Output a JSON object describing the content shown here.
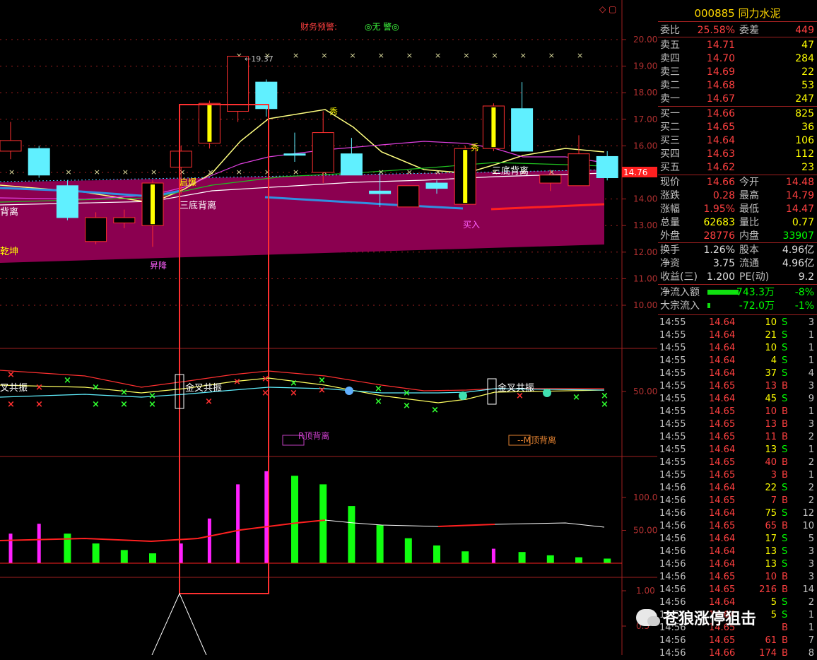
{
  "top_bar": {
    "warn_label": "财务预警:",
    "warn_value": "◎无 警◎"
  },
  "top_icons": "◇ ▢",
  "price_axis": [
    "20.00",
    "19.00",
    "18.00",
    "17.00",
    "16.00",
    "15.00",
    "14.00",
    "13.00",
    "12.00",
    "11.00",
    "10.00"
  ],
  "price_tag": "14.76",
  "max_label": "19.37",
  "chart_labels": {
    "beili_left": "背离",
    "qiankun": "乾坤",
    "sanbei1": "三底背离",
    "qidong": "启爆",
    "xiyang": "昇降",
    "xiu": "秀",
    "qi2": "秀",
    "sanbei2": "三底背离",
    "mairu": "买入"
  },
  "osc_axis": [
    "50.00"
  ],
  "osc_labels": {
    "left": "叉共振",
    "jin1": "金叉共振",
    "jin2": "金叉共振",
    "rding": "R顶背离",
    "mding": "--M顶背离"
  },
  "vol_axis": [
    "100.0",
    "50.00"
  ],
  "bottom_axis": [
    "1.00",
    "0.5"
  ],
  "chart_data": {
    "type": "candlestick",
    "candles": [
      {
        "o": 15.8,
        "c": 16.2,
        "h": 16.9,
        "l": 15.5,
        "color": "red"
      },
      {
        "o": 15.9,
        "c": 14.9,
        "h": 16.0,
        "l": 14.8,
        "color": "cyan"
      },
      {
        "o": 14.5,
        "c": 13.3,
        "h": 14.7,
        "l": 13.2,
        "color": "cyan"
      },
      {
        "o": 12.4,
        "c": 13.3,
        "h": 13.5,
        "l": 12.3,
        "color": "black"
      },
      {
        "o": 13.1,
        "c": 13.3,
        "h": 13.6,
        "l": 12.9,
        "color": "black"
      },
      {
        "o": 13.0,
        "c": 14.6,
        "h": 14.7,
        "l": 12.2,
        "color": "yellow"
      },
      {
        "o": 15.2,
        "c": 15.8,
        "h": 16.0,
        "l": 14.2,
        "color": "red"
      },
      {
        "o": 16.1,
        "c": 17.6,
        "h": 17.7,
        "l": 15.9,
        "color": "yellow"
      },
      {
        "o": 17.3,
        "c": 19.37,
        "h": 19.37,
        "l": 16.9,
        "color": "red"
      },
      {
        "o": 18.4,
        "c": 17.4,
        "h": 18.5,
        "l": 17.1,
        "color": "cyan"
      },
      {
        "o": 15.7,
        "c": 15.7,
        "h": 16.5,
        "l": 15.4,
        "color": "cyan"
      },
      {
        "o": 15.0,
        "c": 16.5,
        "h": 17.3,
        "l": 14.6,
        "color": "red"
      },
      {
        "o": 15.7,
        "c": 14.9,
        "h": 16.3,
        "l": 14.9,
        "color": "cyan"
      },
      {
        "o": 14.2,
        "c": 14.3,
        "h": 15.0,
        "l": 13.7,
        "color": "cyan"
      },
      {
        "o": 14.5,
        "c": 13.7,
        "h": 14.5,
        "l": 13.8,
        "color": "black"
      },
      {
        "o": 14.4,
        "c": 14.6,
        "h": 14.7,
        "l": 14.2,
        "color": "cyan"
      },
      {
        "o": 13.8,
        "c": 15.9,
        "h": 16.0,
        "l": 13.8,
        "color": "yellow"
      },
      {
        "o": 15.9,
        "c": 17.5,
        "h": 17.6,
        "l": 15.8,
        "color": "yellow"
      },
      {
        "o": 17.4,
        "c": 15.8,
        "h": 18.4,
        "l": 15.8,
        "color": "cyan"
      },
      {
        "o": 14.6,
        "c": 14.9,
        "h": 15.1,
        "l": 14.3,
        "color": "red"
      },
      {
        "o": 14.5,
        "c": 15.7,
        "h": 16.4,
        "l": 14.5,
        "color": "red"
      },
      {
        "o": 15.6,
        "c": 14.8,
        "h": 15.8,
        "l": 14.7,
        "color": "cyan"
      }
    ],
    "volume": [
      {
        "v": 45,
        "color": "magenta"
      },
      {
        "v": 60,
        "color": "magenta"
      },
      {
        "v": 45,
        "color": "green"
      },
      {
        "v": 30,
        "color": "green"
      },
      {
        "v": 20,
        "color": "green"
      },
      {
        "v": 15,
        "color": "green"
      },
      {
        "v": 30,
        "color": "magenta"
      },
      {
        "v": 68,
        "color": "magenta"
      },
      {
        "v": 120,
        "color": "magenta"
      },
      {
        "v": 140,
        "color": "magenta"
      },
      {
        "v": 133,
        "color": "green"
      },
      {
        "v": 120,
        "color": "green"
      },
      {
        "v": 87,
        "color": "green"
      },
      {
        "v": 58,
        "color": "green"
      },
      {
        "v": 38,
        "color": "green"
      },
      {
        "v": 27,
        "color": "green"
      },
      {
        "v": 18,
        "color": "green"
      },
      {
        "v": 22,
        "color": "magenta"
      },
      {
        "v": 17,
        "color": "green"
      },
      {
        "v": 12,
        "color": "green"
      },
      {
        "v": 9,
        "color": "green"
      },
      {
        "v": 7,
        "color": "green"
      }
    ],
    "ylim": [
      10,
      20.5
    ]
  },
  "quote": {
    "code": "000885",
    "name": "同力水泥",
    "weibi_label": "委比",
    "weibi": "25.58%",
    "weicha_label": "委差",
    "weicha": "449",
    "sell": [
      [
        "卖五",
        "14.71",
        "47"
      ],
      [
        "卖四",
        "14.70",
        "284"
      ],
      [
        "卖三",
        "14.69",
        "22"
      ],
      [
        "卖二",
        "14.68",
        "53"
      ],
      [
        "卖一",
        "14.67",
        "247"
      ]
    ],
    "buy": [
      [
        "买一",
        "14.66",
        "825"
      ],
      [
        "买二",
        "14.65",
        "36"
      ],
      [
        "买三",
        "14.64",
        "106"
      ],
      [
        "买四",
        "14.63",
        "112"
      ],
      [
        "买五",
        "14.62",
        "23"
      ]
    ],
    "stats": [
      [
        "现价",
        "14.66",
        "今开",
        "14.48"
      ],
      [
        "涨跌",
        "0.28",
        "最高",
        "14.79"
      ],
      [
        "涨幅",
        "1.95%",
        "最低",
        "14.47"
      ],
      [
        "总量",
        "62683",
        "量比",
        "0.77"
      ],
      [
        "外盘",
        "28776",
        "内盘",
        "33907"
      ]
    ],
    "stats2": [
      [
        "换手",
        "1.26%",
        "股本",
        "4.96亿"
      ],
      [
        "净资",
        "3.75",
        "流通",
        "4.96亿"
      ],
      [
        "收益(三)",
        "1.200",
        "PE(动)",
        "9.2"
      ]
    ],
    "flow": [
      [
        "净流入额",
        "-743.3万",
        "-8%"
      ],
      [
        "大宗流入",
        "-72.0万",
        "-1%"
      ]
    ],
    "ticks": [
      [
        "14:55",
        "14.64",
        "10",
        "S",
        "3"
      ],
      [
        "14:55",
        "14.64",
        "21",
        "S",
        "1"
      ],
      [
        "14:55",
        "14.64",
        "10",
        "S",
        "1"
      ],
      [
        "14:55",
        "14.64",
        "4",
        "S",
        "1"
      ],
      [
        "14:55",
        "14.64",
        "37",
        "S",
        "4"
      ],
      [
        "14:55",
        "14.65",
        "13",
        "B",
        "3"
      ],
      [
        "14:55",
        "14.64",
        "45",
        "S",
        "9"
      ],
      [
        "14:55",
        "14.65",
        "10",
        "B",
        "1"
      ],
      [
        "14:55",
        "14.65",
        "13",
        "B",
        "3"
      ],
      [
        "14:55",
        "14.65",
        "11",
        "B",
        "2"
      ],
      [
        "14:55",
        "14.64",
        "13",
        "S",
        "1"
      ],
      [
        "14:55",
        "14.65",
        "40",
        "B",
        "2"
      ],
      [
        "14:55",
        "14.65",
        "3",
        "B",
        "1"
      ],
      [
        "14:56",
        "14.64",
        "22",
        "S",
        "2"
      ],
      [
        "14:56",
        "14.65",
        "7",
        "B",
        "2"
      ],
      [
        "14:56",
        "14.64",
        "75",
        "S",
        "12"
      ],
      [
        "14:56",
        "14.65",
        "65",
        "B",
        "10"
      ],
      [
        "14:56",
        "14.64",
        "17",
        "S",
        "5"
      ],
      [
        "14:56",
        "14.64",
        "13",
        "S",
        "3"
      ],
      [
        "14:56",
        "14.64",
        "13",
        "S",
        "3"
      ],
      [
        "14:56",
        "14.65",
        "10",
        "B",
        "3"
      ],
      [
        "14:56",
        "14.65",
        "216",
        "B",
        "14"
      ],
      [
        "14:56",
        "14.64",
        "5",
        "S",
        "2"
      ],
      [
        "14:56",
        "14.64",
        "5",
        "S",
        "1"
      ],
      [
        "14:56",
        "14.65",
        "",
        "B",
        "1"
      ],
      [
        "14:56",
        "14.65",
        "61",
        "B",
        "7"
      ],
      [
        "14:56",
        "14.66",
        "174",
        "B",
        "8"
      ]
    ]
  },
  "watermark": "苍狼涨停狙击"
}
